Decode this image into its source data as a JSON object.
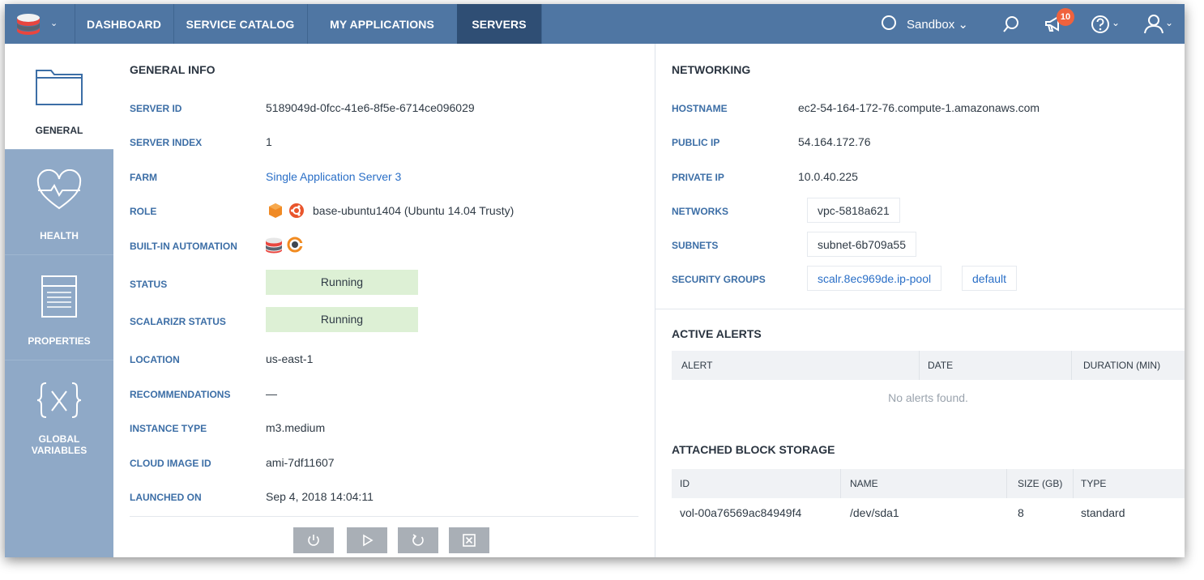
{
  "nav": {
    "items": [
      "DASHBOARD",
      "SERVICE CATALOG",
      "MY APPLICATIONS",
      "SERVERS"
    ],
    "active": "SERVERS",
    "environment": "Sandbox",
    "notification_count": "10"
  },
  "sidebar": {
    "tabs": [
      {
        "label": "GENERAL",
        "icon": "folder-icon"
      },
      {
        "label": "HEALTH",
        "icon": "heart-pulse-icon"
      },
      {
        "label": "PROPERTIES",
        "icon": "properties-list-icon"
      },
      {
        "label": "GLOBAL VARIABLES",
        "icon": "variable-braces-icon"
      }
    ]
  },
  "general_info": {
    "title": "GENERAL INFO",
    "rows": {
      "server_id": {
        "label": "SERVER ID",
        "value": "5189049d-0fcc-41e6-8f5e-6714ce096029"
      },
      "server_index": {
        "label": "SERVER INDEX",
        "value": "1"
      },
      "farm": {
        "label": "FARM",
        "value": "Single Application Server 3"
      },
      "role": {
        "label": "ROLE",
        "value": "base-ubuntu1404 (Ubuntu 14.04 Trusty)"
      },
      "automation": {
        "label": "BUILT-IN AUTOMATION"
      },
      "status": {
        "label": "STATUS",
        "value": "Running"
      },
      "scalarizr": {
        "label": "SCALARIZR STATUS",
        "value": "Running"
      },
      "location": {
        "label": "LOCATION",
        "value": "us-east-1"
      },
      "recommendations": {
        "label": "RECOMMENDATIONS",
        "value": "—"
      },
      "instance_type": {
        "label": "INSTANCE TYPE",
        "value": "m3.medium"
      },
      "cloud_image": {
        "label": "CLOUD IMAGE ID",
        "value": "ami-7df11607"
      },
      "launched": {
        "label": "LAUNCHED ON",
        "value": "Sep 4, 2018 14:04:11"
      }
    }
  },
  "networking": {
    "title": "NETWORKING",
    "rows": {
      "hostname": {
        "label": "HOSTNAME",
        "value": "ec2-54-164-172-76.compute-1.amazonaws.com"
      },
      "public_ip": {
        "label": "PUBLIC IP",
        "value": "54.164.172.76"
      },
      "private_ip": {
        "label": "PRIVATE IP",
        "value": "10.0.40.225"
      },
      "networks": {
        "label": "NETWORKS",
        "value": "vpc-5818a621"
      },
      "subnets": {
        "label": "SUBNETS",
        "value": "subnet-6b709a55"
      },
      "security_groups": {
        "label": "SECURITY GROUPS",
        "values": [
          "scalr.8ec969de.ip-pool",
          "default"
        ]
      }
    }
  },
  "alerts": {
    "title": "ACTIVE ALERTS",
    "columns": [
      "ALERT",
      "DATE",
      "DURATION (MIN)"
    ],
    "empty_text": "No alerts found."
  },
  "storage": {
    "title": "ATTACHED BLOCK STORAGE",
    "columns": [
      "ID",
      "NAME",
      "SIZE (GB)",
      "TYPE"
    ],
    "rows": [
      [
        "vol-00a76569ac84949f4",
        "/dev/sda1",
        "8",
        "standard"
      ]
    ]
  },
  "actions": [
    "power-icon",
    "play-icon",
    "reboot-icon",
    "terminate-icon"
  ],
  "colors": {
    "topbar": "#4f76a3",
    "active_nav": "#2f4e74",
    "sidebar": "#8fa9c7",
    "label_blue": "#3c6ea6",
    "link": "#2a6fc7",
    "running_bg": "#ddf0d5",
    "badge": "#f0623d"
  }
}
